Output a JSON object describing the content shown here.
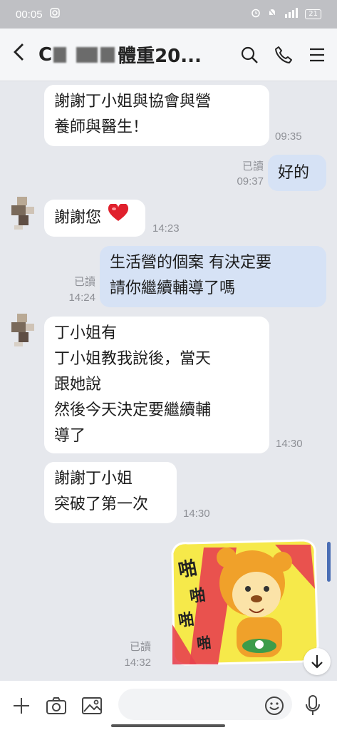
{
  "status_bar": {
    "time": "00:05",
    "battery": "21"
  },
  "header": {
    "title_prefix": "C",
    "title_suffix": "體重20..."
  },
  "messages": [
    {
      "lines": [
        "謝謝丁小姐與協會與營",
        "養師與醫生！"
      ],
      "time": "09:35"
    },
    {
      "lines": [
        "好的"
      ],
      "read": "已讀",
      "time": "09:37"
    },
    {
      "lines": [
        "謝謝您"
      ],
      "time": "14:23"
    },
    {
      "lines": [
        "生活營的個案 有決定要",
        "請你繼續輔導了嗎"
      ],
      "read": "已讀",
      "time": "14:24"
    },
    {
      "lines": [
        "丁小姐有",
        "丁小姐教我說後，當天",
        "跟她說",
        "然後今天決定要繼續輔",
        "導了"
      ],
      "time": "14:30"
    },
    {
      "lines": [
        "謝謝丁小姐",
        "突破了第一次"
      ],
      "time": "14:30"
    },
    {
      "sticker": [
        "啪",
        "啪",
        "啪",
        "啪"
      ],
      "read": "已讀",
      "time": "14:32"
    }
  ],
  "icons": {
    "back": "chevron-left-icon",
    "search": "search-icon",
    "call": "phone-icon",
    "menu": "menu-icon",
    "plus": "plus-icon",
    "camera": "camera-icon",
    "image": "image-icon",
    "emoji": "emoji-icon",
    "mic": "mic-icon",
    "scroll_down": "arrow-down-icon"
  },
  "colors": {
    "outgoing_bubble": "#d6e2f5",
    "incoming_bubble": "#ffffff",
    "background": "#e6e8ed",
    "accent": "#4a6eb5"
  }
}
